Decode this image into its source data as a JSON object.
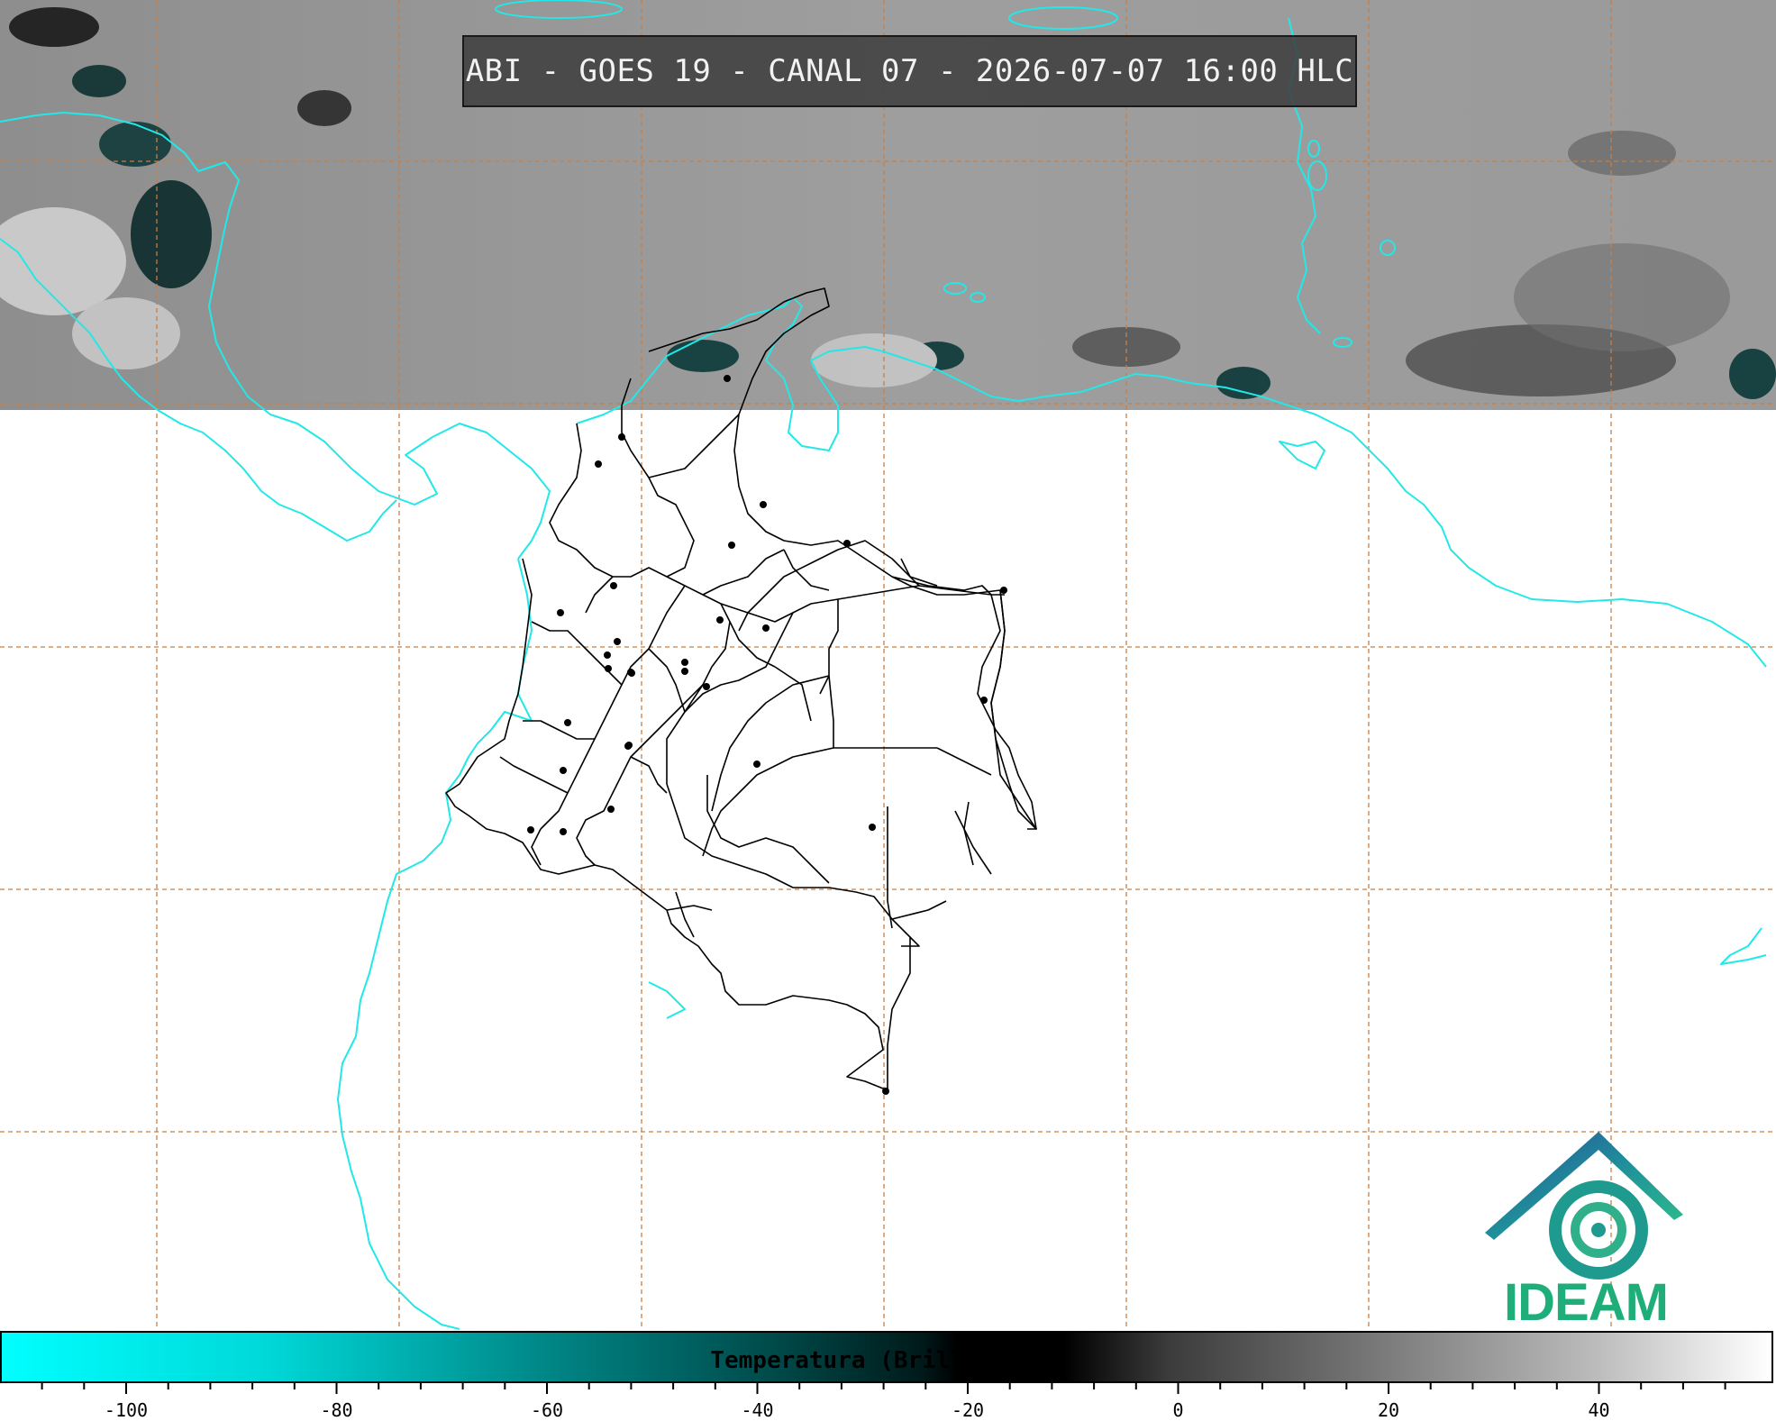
{
  "title": "ABI - GOES 19 - CANAL 07 - 2026-07-07 16:00 HLC",
  "logo": {
    "text": "IDEAM",
    "icon": "ideam-logo-icon"
  },
  "colorbar": {
    "label": "Temperatura (Brillo) (°C)",
    "tick_labels": [
      "-100",
      "-80",
      "-60",
      "-40",
      "-20",
      "0",
      "20",
      "40"
    ],
    "colors": {
      "cold": "#00ffff",
      "mid": "#006060",
      "dark": "#000000",
      "warm": "#ffffff"
    }
  },
  "colors": {
    "coastline": "#22e8e8",
    "borders": "#000000",
    "grid": "#c87f46",
    "satellite_band": "#9a9a9a"
  }
}
